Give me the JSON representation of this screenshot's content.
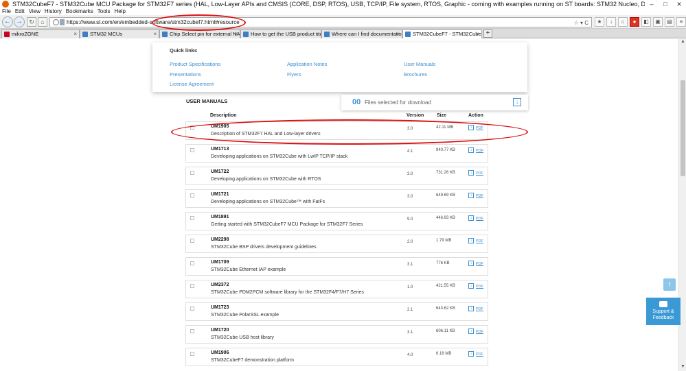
{
  "window": {
    "title": "STM32CubeF7 - STM32Cube MCU Package for STM32F7 series (HAL, Low-Layer APIs and CMSIS (CORE, DSP, RTOS), USB, TCP/IP, File system, RTOS, Graphic - coming with examples running on ST boards: STM32 Nucleo, Discovery kits and Evaluation boards) - STMicroelec",
    "min": "–",
    "max": "□",
    "close": "✕"
  },
  "menu": [
    "File",
    "Edit",
    "View",
    "History",
    "Bookmarks",
    "Tools",
    "Help"
  ],
  "nav": {
    "url": "https://www.st.com/en/embedded-software/stm32cubef7.html#resource",
    "url_right": "☆ ▾ C"
  },
  "tabs": [
    {
      "label": "mikroZONE",
      "close": "×"
    },
    {
      "label": "STM32 MCUs",
      "close": "×"
    },
    {
      "label": "Chip Select pin for external NAND...",
      "close": "×"
    },
    {
      "label": "How to get the USB product string...",
      "close": "×"
    },
    {
      "label": "Where can I find documentation...",
      "close": "×"
    },
    {
      "label": "STM32CubeF7 - STM32Cube MCU...",
      "close": "×"
    }
  ],
  "quick_links": {
    "title": "Quick links",
    "links": [
      "Product Specifications",
      "Application Notes",
      "User Manuals",
      "Presentations",
      "Flyers",
      "Brochures",
      "License Agreement"
    ]
  },
  "user_manuals": {
    "title": "USER MANUALS",
    "files_count": "00",
    "files_label": "Files selected for download",
    "columns": {
      "description": "Description",
      "version": "Version",
      "size": "Size",
      "action": "Action"
    },
    "rows": [
      {
        "code": "UM1905",
        "desc": "Description of STM32F7 HAL and Low-layer drivers",
        "ver": "3.0",
        "size": "42.11 MB"
      },
      {
        "code": "UM1713",
        "desc": "Developing applications on STM32Cube with LwIP TCP/IP stack",
        "ver": "4.1",
        "size": "940.77 KB"
      },
      {
        "code": "UM1722",
        "desc": "Developing applications on STM32Cube with RTOS",
        "ver": "3.0",
        "size": "731.26 KB"
      },
      {
        "code": "UM1721",
        "desc": "Developing applications on STM32Cube™ with FatFs",
        "ver": "3.0",
        "size": "649.69 KB"
      },
      {
        "code": "UM1891",
        "desc": "Getting started with STM32CubeF7 MCU Package for STM32F7 Series",
        "ver": "9.0",
        "size": "446.93 KB"
      },
      {
        "code": "UM2298",
        "desc": "STM32Cube BSP drivers development guidelines",
        "ver": "2.0",
        "size": "1.79 MB"
      },
      {
        "code": "UM1709",
        "desc": "STM32Cube Ethernet IAP example",
        "ver": "3.1",
        "size": "776 KB"
      },
      {
        "code": "UM2372",
        "desc": "STM32Cube PDM2PCM software library for the STM32F4/F7/H7 Series",
        "ver": "1.0",
        "size": "421.55 KB"
      },
      {
        "code": "UM1723",
        "desc": "STM32Cube PolarSSL example",
        "ver": "2.1",
        "size": "643.62 KB"
      },
      {
        "code": "UM1720",
        "desc": "STM32Cube USB host library",
        "ver": "3.1",
        "size": "606.11 KB"
      },
      {
        "code": "UM1906",
        "desc": "STM32CubeF7 demonstration platform",
        "ver": "4.0",
        "size": "6.18 MB"
      }
    ],
    "pdf_label": "PDF"
  },
  "support": {
    "line1": "Support &",
    "line2": "Feedback"
  },
  "top_arrow": "↑"
}
